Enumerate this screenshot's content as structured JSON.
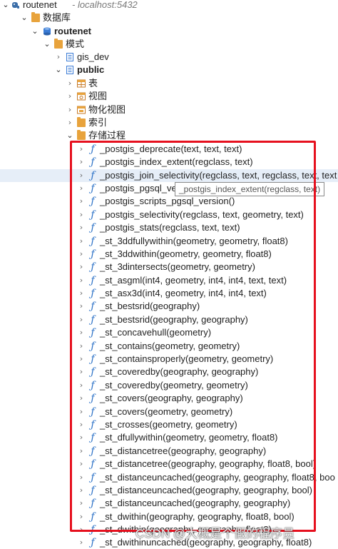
{
  "connection": {
    "name": "routenet",
    "host": "- localhost:5432"
  },
  "databases_label": "数据库",
  "database": {
    "name": "routenet"
  },
  "schemas_label": "模式",
  "schemas": [
    {
      "name": "gis_dev"
    },
    {
      "name": "public"
    }
  ],
  "public_children": [
    "表",
    "视图",
    "物化视图",
    "索引",
    "存储过程"
  ],
  "functions": [
    "_postgis_deprecate(text, text, text)",
    "_postgis_index_extent(regclass, text)",
    "_postgis_join_selectivity(regclass, text, regclass, text, text",
    "_postgis_pgsql_ve",
    "_postgis_scripts_pgsql_version()",
    "_postgis_selectivity(regclass, text, geometry, text)",
    "_postgis_stats(regclass, text, text)",
    "_st_3ddfullywithin(geometry, geometry, float8)",
    "_st_3ddwithin(geometry, geometry, float8)",
    "_st_3dintersects(geometry, geometry)",
    "_st_asgml(int4, geometry, int4, int4, text, text)",
    "_st_asx3d(int4, geometry, int4, int4, text)",
    "_st_bestsrid(geography)",
    "_st_bestsrid(geography, geography)",
    "_st_concavehull(geometry)",
    "_st_contains(geometry, geometry)",
    "_st_containsproperly(geometry, geometry)",
    "_st_coveredby(geography, geography)",
    "_st_coveredby(geometry, geometry)",
    "_st_covers(geography, geography)",
    "_st_covers(geometry, geometry)",
    "_st_crosses(geometry, geometry)",
    "_st_dfullywithin(geometry, geometry, float8)",
    "_st_distancetree(geography, geography)",
    "_st_distancetree(geography, geography, float8, bool)",
    "_st_distanceuncached(geography, geography, float8, boo",
    "_st_distanceuncached(geography, geography, bool)",
    "_st_distanceuncached(geography, geography)",
    "_st_dwithin(geography, geography, float8, bool)",
    "_st_dwithin(geography, geography, float8)",
    "_st_dwithinuncached(geography, geography, float8)"
  ],
  "tooltip": "_postgis_index_extent(regclass, text)",
  "watermark": "CSDN @大概是个假的程序员",
  "colors": {
    "highlight_box": "#e6101e",
    "function_icon": "#2a70c6",
    "folder_icon": "#e8a33c",
    "selected_row": "#e6eef8"
  },
  "icons": {
    "connection": "elephant-db-icon",
    "databases": "folder-icon",
    "database": "database-icon",
    "schemas": "folder-icon",
    "schema": "schema-icon",
    "tables": "table-icon",
    "views": "view-icon",
    "materialized_views": "matview-icon",
    "indexes": "folder-icon",
    "procedures": "folder-icon",
    "function": "function-icon"
  }
}
